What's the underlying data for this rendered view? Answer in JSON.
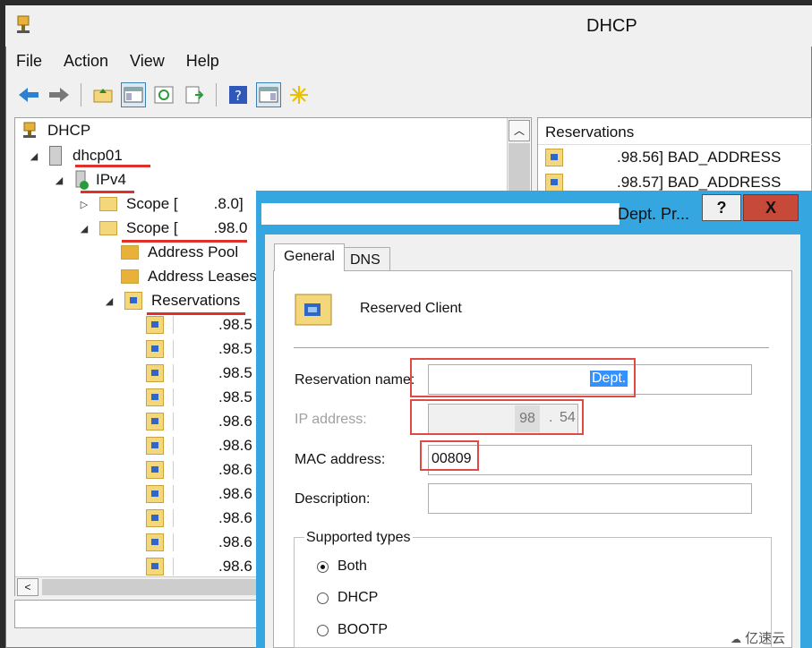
{
  "window": {
    "title": "DHCP"
  },
  "menu": [
    "File",
    "Action",
    "View",
    "Help"
  ],
  "toolbar": {
    "icons": [
      "back-arrow-icon",
      "forward-arrow-icon",
      "up-folder-icon",
      "show-hide-tree-icon",
      "refresh-icon",
      "export-list-icon",
      "help-icon",
      "show-action-pane-icon",
      "new-star-icon"
    ]
  },
  "tree": {
    "root": "DHCP",
    "server": "dhcp01",
    "ipv4": "IPv4",
    "scope1": {
      "label": "Scope [",
      "suffix": ".8.0]"
    },
    "scope2": {
      "label": "Scope [",
      "suffix": ".98.0"
    },
    "address_pool": "Address Pool",
    "address_leases": "Address Leases",
    "reservations": "Reservations",
    "reservation_items": [
      ".98.5",
      ".98.5",
      ".98.5",
      ".98.5",
      ".98.6",
      ".98.6",
      ".98.6",
      ".98.6",
      ".98.6",
      ".98.6",
      ".98.6"
    ]
  },
  "right_pane": {
    "header": "Reservations",
    "rows": [
      ".98.56] BAD_ADDRESS",
      ".98.57] BAD_ADDRESS"
    ]
  },
  "dialog": {
    "title_fragment": "Dept. Pr...",
    "help_button": "?",
    "close_button": "X",
    "tabs": [
      "General",
      "DNS"
    ],
    "heading": "Reserved Client",
    "reservation_name_label": "Reservation name:",
    "reservation_name_value": "Dept.",
    "ip_address_label": "IP address:",
    "ip_octet3": "98",
    "ip_dot": ".",
    "ip_octet4": "54",
    "mac_address_label": "MAC address:",
    "mac_address_value": "00809",
    "description_label": "Description:",
    "supported_types_label": "Supported types",
    "radio_options": [
      "Both",
      "DHCP",
      "BOOTP"
    ],
    "selected_type": "Both"
  },
  "watermark": "亿速云",
  "colors": {
    "dialog_frame": "#36a6e1",
    "annotation_red": "#e0302a",
    "close_button": "#c7493a"
  }
}
